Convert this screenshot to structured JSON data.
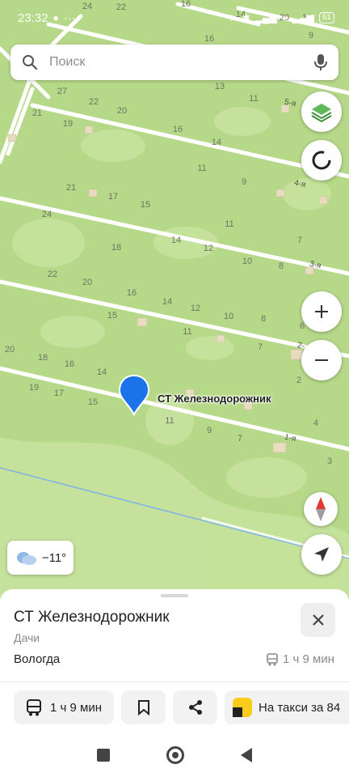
{
  "status_bar": {
    "time": "23:32",
    "dots": "···",
    "battery": "61"
  },
  "search": {
    "placeholder": "Поиск"
  },
  "map": {
    "poi_label": "СТ Железнодорожник",
    "street_labels": [
      "5-я",
      "4-я",
      "3-я",
      "2-",
      "1-я"
    ],
    "plot_numbers": [
      "24",
      "22",
      "16",
      "20",
      "18",
      "16",
      "14",
      "13",
      "11",
      "9",
      "27",
      "22",
      "20",
      "21",
      "19",
      "16",
      "14",
      "11",
      "9",
      "21",
      "17",
      "15",
      "24",
      "11",
      "18",
      "14",
      "12",
      "10",
      "8",
      "7",
      "22",
      "20",
      "16",
      "14",
      "12",
      "10",
      "8",
      "15",
      "11",
      "7",
      "6",
      "20",
      "18",
      "16",
      "14",
      "19",
      "17",
      "15",
      "11",
      "9",
      "7",
      "4",
      "3",
      "2"
    ]
  },
  "weather": {
    "temp": "−11°"
  },
  "place": {
    "title": "СТ Железнодорожник",
    "category": "Дачи",
    "city": "Вологда",
    "transit_time": "1 ч 9 мин"
  },
  "actions": {
    "route_label": "1 ч 9 мин",
    "taxi_label": "На такси за 84"
  },
  "colors": {
    "map_bg": "#b6d989",
    "marker": "#1a73e8",
    "taxi": "#fccc1b"
  }
}
